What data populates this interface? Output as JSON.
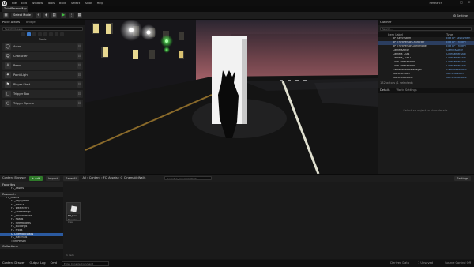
{
  "menubar": {
    "items": [
      "File",
      "Edit",
      "Window",
      "Tools",
      "Build",
      "Select",
      "Actor",
      "Help"
    ],
    "project": "Research"
  },
  "map_tab": "ThirdPersonMap",
  "toolbar": {
    "mode": "Select Mode",
    "settings": "Settings"
  },
  "place_actors": {
    "tabs": [
      "Place Actors",
      "Bridge"
    ],
    "search_placeholder": "Search Classes",
    "category": "Basic",
    "items": [
      "Actor",
      "Character",
      "Pawn",
      "Point Light",
      "Player Start",
      "Trigger Box",
      "Trigger Sphere"
    ]
  },
  "outliner": {
    "tab": "Outliner",
    "search_placeholder": "Search...",
    "col_label": "Item Label",
    "col_type": "Type",
    "rows": [
      {
        "name": "BP_SkySystem",
        "type": "Edit BP_SkySystem"
      },
      {
        "name": "BP_ThirdPersonCharacter",
        "type": "Edit BP_ThirdPe"
      },
      {
        "name": "BP_ThirdPersonGameMode",
        "type": "Edit BP_ThirdPe"
      },
      {
        "name": "CameraActor",
        "type": "CameraActor"
      },
      {
        "name": "Camera_Cuts",
        "type": "CineCameraAct"
      },
      {
        "name": "Camera_Cuts2",
        "type": "CineCameraAct"
      },
      {
        "name": "CineCameraActor",
        "type": "CineCameraAct"
      },
      {
        "name": "CineCameraActor2",
        "type": "CineCameraAct"
      },
      {
        "name": "GameNetworkManager",
        "type": "GameNetworkM"
      },
      {
        "name": "GameSession",
        "type": "GameSession"
      },
      {
        "name": "GameStateBase",
        "type": "GameStateBase"
      }
    ],
    "status": "182 actors (1 selected)"
  },
  "details": {
    "tabs": [
      "Details",
      "World Settings"
    ],
    "empty": "Select an object to view details."
  },
  "content_browser": {
    "tab": "Content Browser",
    "add": "+ Add",
    "import": "Import",
    "save_all": "Save All",
    "breadcrumb": [
      "All",
      "Content",
      "FC_Assets",
      "C_CinematicWalls"
    ],
    "search_placeholder": "Search C_CinematicWalls",
    "settings": "Settings",
    "sections": [
      "Favorites",
      "Research",
      "Collections"
    ],
    "favorite_item": "FC_Assets",
    "tree": [
      "FC_Assets",
      "FC_SkySystem",
      "FC_PostFX",
      "FC_WeatherFX",
      "FC_CameraRigs",
      "FC_Environment",
      "FC_Roads",
      "FC_StreetLights",
      "FC_Buildings",
      "FC_Props",
      "C_CinematicWalls",
      "FC_Materials",
      "ThirdPerson"
    ],
    "asset_name": "BP_Box",
    "asset_type": "Blueprint Class",
    "item_count": "1 item"
  },
  "statusbar": {
    "drawer": "Content Drawer",
    "output": "Output Log",
    "cmd": "Cmd",
    "cmd_placeholder": "Enter Console Command",
    "derived": "Derived Data",
    "unsaved": "1 Unsaved",
    "source": "Source Control Off"
  }
}
